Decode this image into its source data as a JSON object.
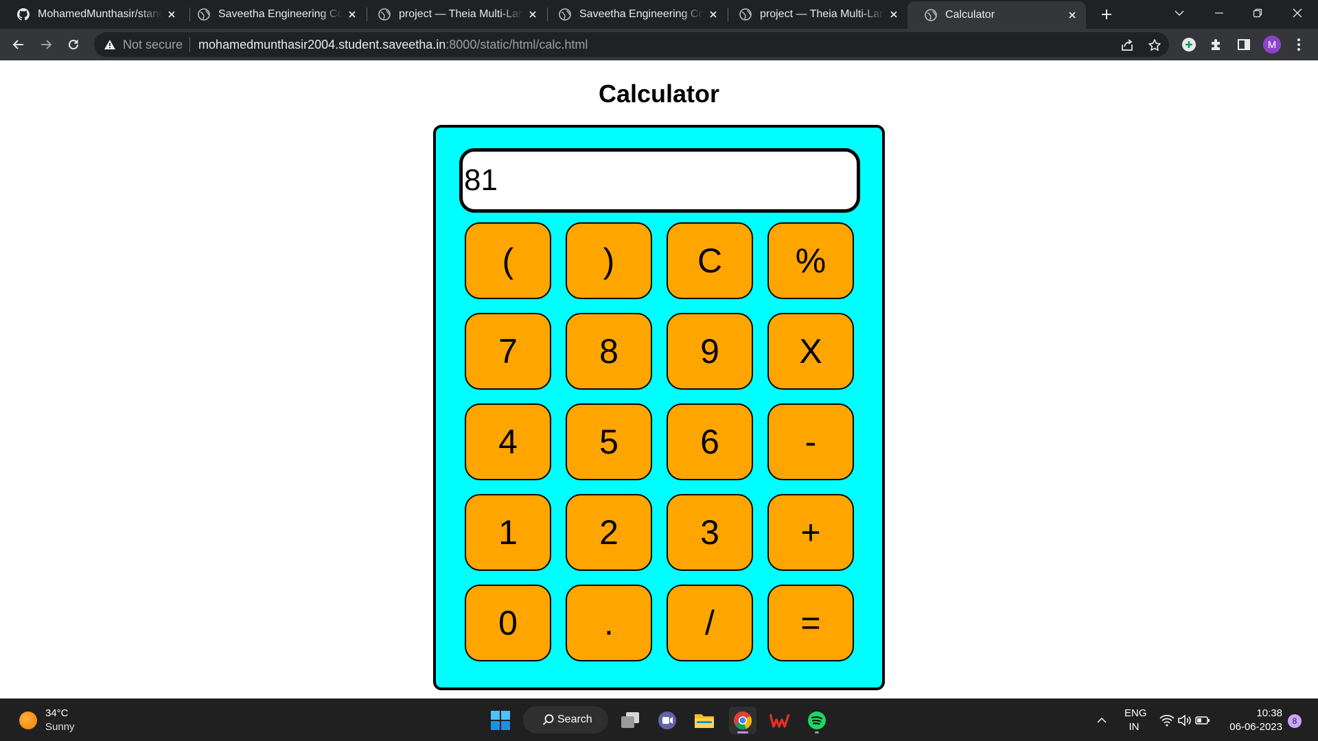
{
  "tabs": [
    {
      "title": "MohamedMunthasir/standard-calculator",
      "favicon": "github-icon",
      "active": false
    },
    {
      "title": "Saveetha Engineering College",
      "favicon": "globe-icon",
      "active": false
    },
    {
      "title": "project — Theia Multi-Language",
      "favicon": "globe-icon",
      "active": false
    },
    {
      "title": "Saveetha Engineering College",
      "favicon": "globe-icon",
      "active": false
    },
    {
      "title": "project — Theia Multi-Language",
      "favicon": "globe-icon",
      "active": false
    },
    {
      "title": "Calculator",
      "favicon": "globe-icon",
      "active": true
    }
  ],
  "omnibox": {
    "security_label": "Not secure",
    "url_host": "mohamedmunthasir2004.student.saveetha.in",
    "url_path": ":8000/static/html/calc.html"
  },
  "profile": {
    "initial": "M",
    "color": "#8e44c9"
  },
  "page": {
    "title": "Calculator",
    "display_value": "81",
    "colors": {
      "body": "#00ffff",
      "key": "#ffa500",
      "border": "#000000"
    },
    "keys": [
      [
        "(",
        ")",
        "C",
        "%"
      ],
      [
        "7",
        "8",
        "9",
        "X"
      ],
      [
        "4",
        "5",
        "6",
        "-"
      ],
      [
        "1",
        "2",
        "3",
        "+"
      ],
      [
        "0",
        ".",
        "/",
        "="
      ]
    ]
  },
  "taskbar": {
    "weather": {
      "temp": "34°C",
      "desc": "Sunny"
    },
    "search_label": "Search",
    "apps": [
      "windows-start-icon",
      "task-view-icon",
      "teams-chat-icon",
      "file-explorer-icon",
      "chrome-icon",
      "wps-office-icon",
      "spotify-icon"
    ],
    "language": {
      "line1": "ENG",
      "line2": "IN"
    },
    "clock": {
      "time": "10:38",
      "date": "06-06-2023"
    },
    "notifications": "8"
  }
}
